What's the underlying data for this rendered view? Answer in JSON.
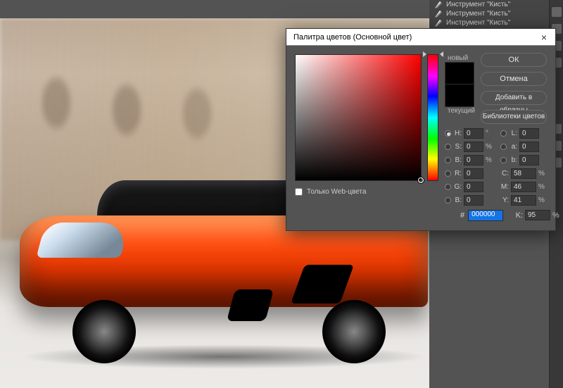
{
  "tools": {
    "items": [
      {
        "label": "Инструмент \"Кисть\""
      },
      {
        "label": "Инструмент \"Кисть\""
      },
      {
        "label": "Инструмент \"Кисть\""
      }
    ]
  },
  "dialog": {
    "title": "Палитра цветов (Основной цвет)",
    "close": "×",
    "swatch": {
      "new_label": "новый",
      "current_label": "текущий"
    },
    "web_only_label": "Только Web-цвета",
    "buttons": {
      "ok": "ОК",
      "cancel": "Отмена",
      "add_swatch": "Добавить в образцы",
      "libraries": "Библиотеки цветов"
    },
    "fields": {
      "H": {
        "label": "H:",
        "value": "0",
        "unit": "°"
      },
      "S": {
        "label": "S:",
        "value": "0",
        "unit": "%"
      },
      "Bv": {
        "label": "B:",
        "value": "0",
        "unit": "%"
      },
      "R": {
        "label": "R:",
        "value": "0"
      },
      "G": {
        "label": "G:",
        "value": "0"
      },
      "Bc": {
        "label": "B:",
        "value": "0"
      },
      "L": {
        "label": "L:",
        "value": "0"
      },
      "a": {
        "label": "a:",
        "value": "0"
      },
      "b": {
        "label": "b:",
        "value": "0"
      },
      "C": {
        "label": "C:",
        "value": "58",
        "unit": "%"
      },
      "M": {
        "label": "M:",
        "value": "46",
        "unit": "%"
      },
      "Y": {
        "label": "Y:",
        "value": "41",
        "unit": "%"
      },
      "K": {
        "label": "K:",
        "value": "95",
        "unit": "%"
      },
      "hex": {
        "label": "#",
        "value": "000000"
      }
    }
  }
}
